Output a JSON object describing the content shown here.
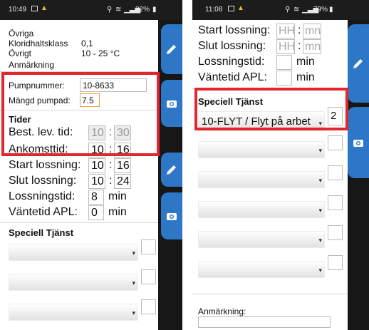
{
  "left": {
    "status": {
      "time": "10:49",
      "battery": "82%"
    },
    "header": {
      "ovriga": "Övriga",
      "klorid_label": "Kloridhaltsklass",
      "klorid_value": "0,1",
      "ovrigt_label": "Övrigt",
      "ovrigt_value": "10 - 25 °C",
      "anmarkning_label": "Anmärkning"
    },
    "pump": {
      "pumpnummer_label": "Pumpnummer:",
      "pumpnummer_value": "10-8633",
      "mangd_label": "Mängd pumpad:",
      "mangd_value": "7.5"
    },
    "tider": {
      "heading": "Tider",
      "best_label": "Best. lev. tid:",
      "best_h": "10",
      "best_m": "30",
      "ankomst_label": "Ankomsttid:",
      "ankomst_h": "10",
      "ankomst_m": "16",
      "start_label": "Start lossning:",
      "start_h": "10",
      "start_m": "16",
      "slut_label": "Slut lossning:",
      "slut_h": "10",
      "slut_m": "24",
      "lossningstid_label": "Lossningstid:",
      "lossningstid_value": "8",
      "lossningstid_unit": "min",
      "vantetid_label": "Väntetid APL:",
      "vantetid_value": "0",
      "vantetid_unit": "min"
    },
    "speciell": {
      "heading": "Speciell Tjänst"
    },
    "colon": ":"
  },
  "right": {
    "status": {
      "time": "11:08",
      "battery": "79%"
    },
    "tider": {
      "start_label": "Start lossning:",
      "start_h_ph": "HH",
      "start_m_ph": "mn",
      "slut_label": "Slut lossning:",
      "slut_h_ph": "HH",
      "slut_m_ph": "mn",
      "lossningstid_label": "Lossningstid:",
      "lossningstid_unit": "min",
      "vantetid_label": "Väntetid APL:",
      "vantetid_unit": "min"
    },
    "speciell": {
      "heading": "Speciell Tjänst",
      "selected": "10-FLYT / Flyt på arbet",
      "quantity": "2"
    },
    "anmarkning_label": "Anmärkning:",
    "colon": ":"
  },
  "colors": {
    "accent": "#2e76c6",
    "highlight": "#e3262e",
    "input_orange": "#f0a040"
  },
  "icons": [
    "image-icon",
    "warning-icon",
    "location-icon",
    "wifi-icon",
    "signal-icon",
    "battery-icon",
    "pencil-icon",
    "camera-icon"
  ]
}
